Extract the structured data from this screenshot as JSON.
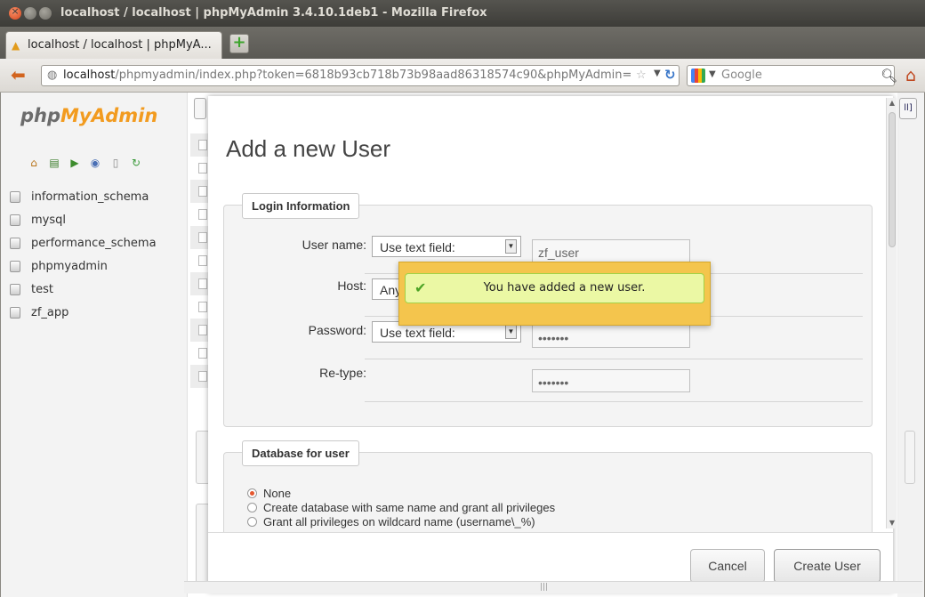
{
  "window": {
    "title": "localhost / localhost | phpMyAdmin 3.4.10.1deb1 - Mozilla Firefox"
  },
  "tab": {
    "label": "localhost / localhost | phpMyA..."
  },
  "navbar": {
    "url_host": "localhost",
    "url_path": "/phpmyadmin/index.php?token=6818b93cb718b73b98aad86318574c90&phpMyAdmin=",
    "search_placeholder": "Google"
  },
  "sidebar": {
    "logo_php": "php",
    "logo_myadmin": "MyAdmin",
    "databases": [
      "information_schema",
      "mysql",
      "performance_schema",
      "phpmyadmin",
      "test",
      "zf_app"
    ]
  },
  "dialog": {
    "title": "Add a new User",
    "login_legend": "Login Information",
    "username_label": "User name:",
    "username_select": "Use text field:",
    "username_value": "zf_user",
    "host_label": "Host:",
    "host_select": "Any",
    "password_label": "Password:",
    "password_select": "Use text field:",
    "password_value": "•••••••",
    "retype_label": "Re-type:",
    "retype_value": "•••••••",
    "db_legend": "Database for user",
    "db_options": [
      {
        "label": "None",
        "selected": true
      },
      {
        "label": "Create database with same name and grant all privileges",
        "selected": false
      },
      {
        "label": "Grant all privileges on wildcard name (username\\_%)",
        "selected": false
      }
    ],
    "cancel_label": "Cancel",
    "create_label": "Create User"
  },
  "notification": {
    "message": "You have added a new user."
  },
  "colors": {
    "notify_bg": "#f4c54d",
    "notify_inner": "#ebf8a4",
    "logo_accent": "#f29b1f"
  }
}
